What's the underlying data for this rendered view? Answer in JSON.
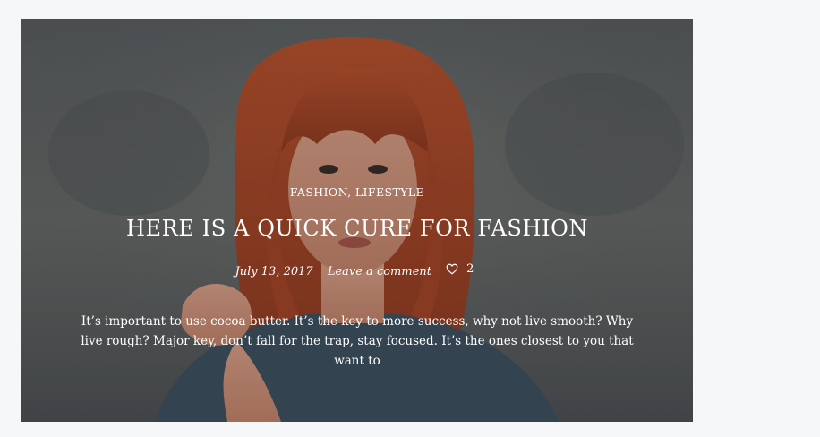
{
  "post": {
    "categories": [
      "FASHION",
      "LIFESTYLE"
    ],
    "category_separator": ", ",
    "title": "HERE IS A QUICK CURE FOR FASHION",
    "date": "July 13, 2017",
    "comment_link": "Leave a comment",
    "likes_count": "2",
    "excerpt": "It’s important to use cocoa butter. It’s the key to more success, why not live smooth? Why live rough? Major key, don’t fall for the trap, stay focused. It’s the ones closest to you that want to"
  },
  "icons": {
    "like": "heart-icon"
  },
  "colors": {
    "page_background": "#f6f7f9",
    "overlay_text": "#ffffff",
    "hair": "#b44a2a"
  }
}
